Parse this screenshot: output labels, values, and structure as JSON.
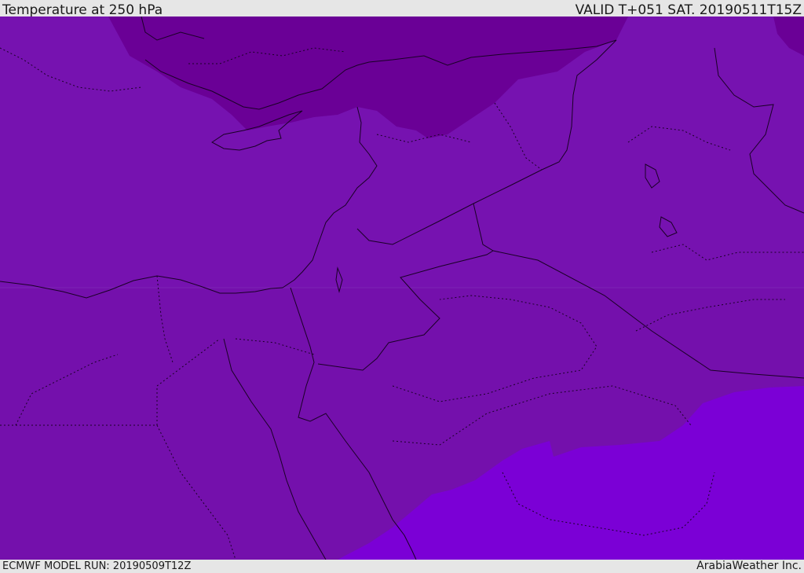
{
  "header": {
    "title": "Temperature at 250 hPa",
    "valid_time": "VALID T+051 SAT. 20190511T15Z"
  },
  "footer": {
    "model_run": "ECMWF MODEL RUN: 20190509T12Z",
    "brand": "ArabiaWeather Inc."
  },
  "map": {
    "fill_colors": {
      "dark_north": "#6a0096",
      "main": "#7612b0",
      "mid": "#7410ac",
      "light_south": "#7b00d6"
    },
    "border_color": "#1a0026"
  }
}
